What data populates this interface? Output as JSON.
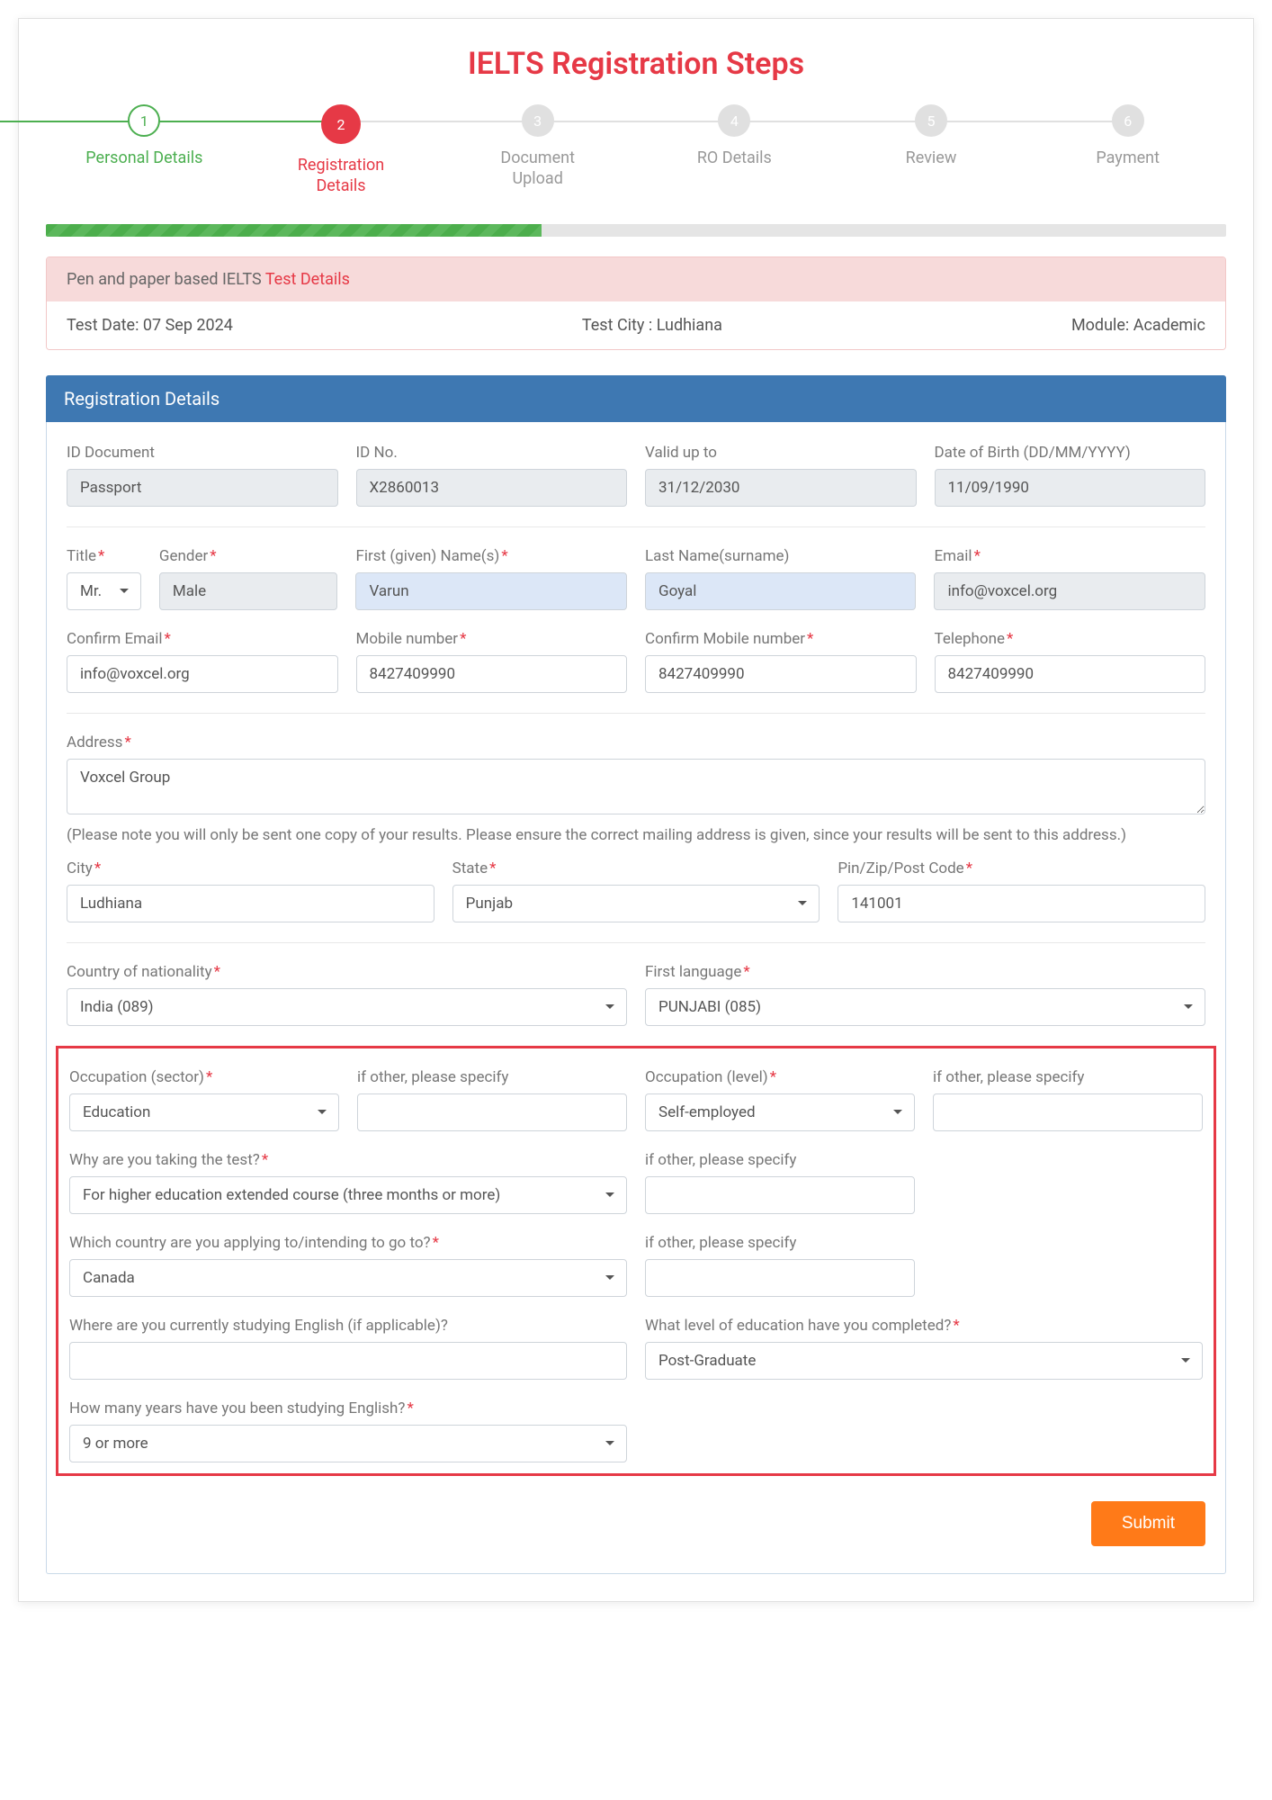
{
  "title": "IELTS Registration Steps",
  "steps": [
    {
      "num": "1",
      "label": "Personal Details",
      "status": "completed"
    },
    {
      "num": "2",
      "label": "Registration Details",
      "status": "active"
    },
    {
      "num": "3",
      "label": "Document Upload",
      "status": ""
    },
    {
      "num": "4",
      "label": "RO Details",
      "status": ""
    },
    {
      "num": "5",
      "label": "Review",
      "status": ""
    },
    {
      "num": "6",
      "label": "Payment",
      "status": ""
    }
  ],
  "banner": {
    "prefix": "Pen and paper based IELTS ",
    "link": "Test Details",
    "test_date": "Test Date: 07 Sep 2024",
    "test_city": "Test City : Ludhiana",
    "module": "Module: Academic"
  },
  "section_title": "Registration Details",
  "labels": {
    "id_doc": "ID Document",
    "id_no": "ID No.",
    "valid_upto": "Valid up to",
    "dob": "Date of Birth (DD/MM/YYYY)",
    "title": "Title",
    "gender": "Gender",
    "first_name": "First (given) Name(s)",
    "last_name": "Last Name(surname)",
    "email": "Email",
    "confirm_email": "Confirm Email",
    "mobile": "Mobile number",
    "confirm_mobile": "Confirm Mobile number",
    "telephone": "Telephone",
    "address": "Address",
    "address_note": "(Please note you will only be sent one copy of your results. Please ensure the correct mailing address is given, since your results will be sent to this address.)",
    "city": "City",
    "state": "State",
    "pin": "Pin/Zip/Post Code",
    "nationality": "Country of nationality",
    "first_language": "First language",
    "occ_sector": "Occupation (sector)",
    "occ_sector_other": "if other, please specify",
    "occ_level": "Occupation (level)",
    "occ_level_other": "if other, please specify",
    "why_test": "Why are you taking the test?",
    "why_test_other": "if other, please specify",
    "country_apply": "Which country are you applying to/intending to go to?",
    "country_apply_other": "if other, please specify",
    "study_where": "Where are you currently studying English (if applicable)?",
    "education_level": "What level of education have you completed?",
    "years_english": "How many years have you been studying English?"
  },
  "values": {
    "id_doc": "Passport",
    "id_no": "X2860013",
    "valid_upto": "31/12/2030",
    "dob": "11/09/1990",
    "title": "Mr.",
    "gender": "Male",
    "first_name": "Varun",
    "last_name": "Goyal",
    "email": "info@voxcel.org",
    "confirm_email": "info@voxcel.org",
    "mobile": "8427409990",
    "confirm_mobile": "8427409990",
    "telephone": "8427409990",
    "address": "Voxcel Group",
    "city": "Ludhiana",
    "state": "Punjab",
    "pin": "141001",
    "nationality": "India (089)",
    "first_language": "PUNJABI (085)",
    "occ_sector": "Education",
    "occ_level": "Self-employed",
    "why_test": "For higher education extended course (three months or more)",
    "country_apply": "Canada",
    "education_level": "Post-Graduate",
    "years_english": "9 or more"
  },
  "submit_label": "Submit"
}
